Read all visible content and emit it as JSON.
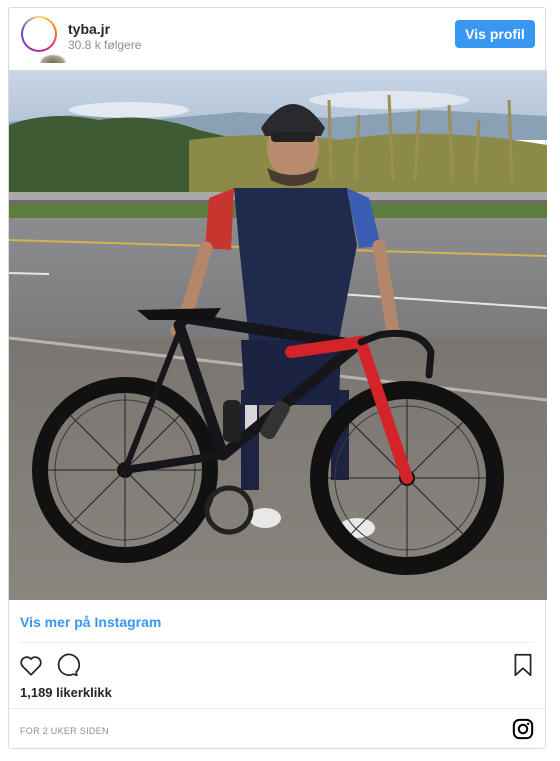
{
  "header": {
    "username": "tyba.jr",
    "followers": "30.8 k følgere",
    "profile_button": "Vis profil"
  },
  "post": {
    "image_description_icons": [
      "photo"
    ],
    "view_more": "Vis mer på Instagram",
    "likes": "1,189 likerklikk",
    "timestamp": "FOR 2 UKER SIDEN"
  },
  "colors": {
    "accent": "#3897f0",
    "text": "#262626",
    "muted": "#8e8e8e",
    "border": "#dbdbdb"
  },
  "icons": {
    "like": "heart-icon",
    "comment": "comment-icon",
    "save": "bookmark-icon",
    "brand": "instagram-icon"
  }
}
